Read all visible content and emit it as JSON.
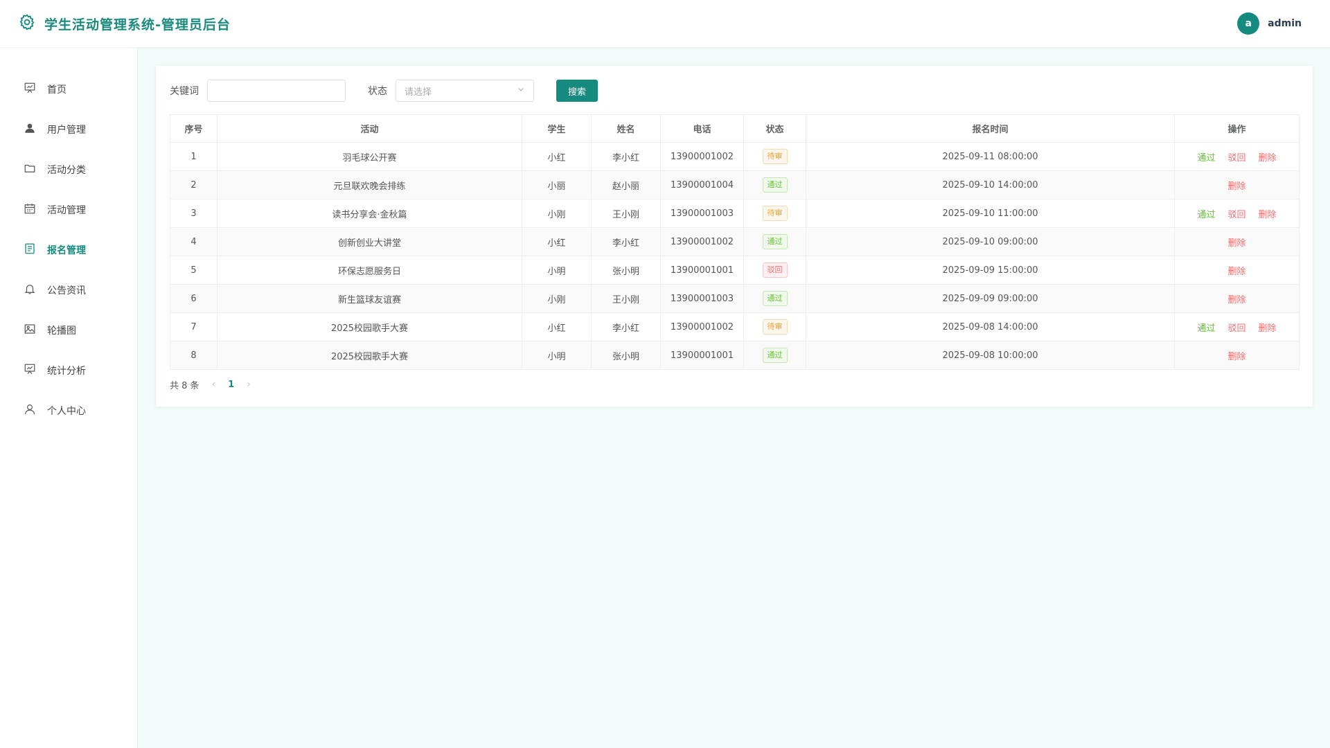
{
  "header": {
    "title": "学生活动管理系统-管理员后台",
    "avatar_letter": "a",
    "username": "admin"
  },
  "sidebar": {
    "items": [
      {
        "label": "首页",
        "icon": "presentation-icon",
        "active": false
      },
      {
        "label": "用户管理",
        "icon": "user-solid-icon",
        "active": false
      },
      {
        "label": "活动分类",
        "icon": "folder-icon",
        "active": false
      },
      {
        "label": "活动管理",
        "icon": "calendar-icon",
        "active": false
      },
      {
        "label": "报名管理",
        "icon": "document-icon",
        "active": true
      },
      {
        "label": "公告资讯",
        "icon": "bell-icon",
        "active": false
      },
      {
        "label": "轮播图",
        "icon": "picture-icon",
        "active": false
      },
      {
        "label": "统计分析",
        "icon": "chart-board-icon",
        "active": false
      },
      {
        "label": "个人中心",
        "icon": "user-outline-icon",
        "active": false
      }
    ]
  },
  "search": {
    "keyword_label": "关键词",
    "keyword_value": "",
    "keyword_placeholder": "",
    "status_label": "状态",
    "status_placeholder": "请选择",
    "button_label": "搜索"
  },
  "table": {
    "columns": [
      "序号",
      "活动",
      "学生",
      "姓名",
      "电话",
      "状态",
      "报名时间",
      "操作"
    ],
    "rows": [
      {
        "index": "1",
        "activity": "羽毛球公开赛",
        "student": "小红",
        "name": "李小红",
        "phone": "13900001002",
        "status": "待审",
        "status_type": "pending",
        "time": "2025-09-11 08:00:00"
      },
      {
        "index": "2",
        "activity": "元旦联欢晚会排练",
        "student": "小丽",
        "name": "赵小丽",
        "phone": "13900001004",
        "status": "通过",
        "status_type": "pass",
        "time": "2025-09-10 14:00:00"
      },
      {
        "index": "3",
        "activity": "读书分享会·金秋篇",
        "student": "小刚",
        "name": "王小刚",
        "phone": "13900001003",
        "status": "待审",
        "status_type": "pending",
        "time": "2025-09-10 11:00:00"
      },
      {
        "index": "4",
        "activity": "创新创业大讲堂",
        "student": "小红",
        "name": "李小红",
        "phone": "13900001002",
        "status": "通过",
        "status_type": "pass",
        "time": "2025-09-10 09:00:00"
      },
      {
        "index": "5",
        "activity": "环保志愿服务日",
        "student": "小明",
        "name": "张小明",
        "phone": "13900001001",
        "status": "驳回",
        "status_type": "reject",
        "time": "2025-09-09 15:00:00"
      },
      {
        "index": "6",
        "activity": "新生篮球友谊赛",
        "student": "小刚",
        "name": "王小刚",
        "phone": "13900001003",
        "status": "通过",
        "status_type": "pass",
        "time": "2025-09-09 09:00:00"
      },
      {
        "index": "7",
        "activity": "2025校园歌手大赛",
        "student": "小红",
        "name": "李小红",
        "phone": "13900001002",
        "status": "待审",
        "status_type": "pending",
        "time": "2025-09-08 14:00:00"
      },
      {
        "index": "8",
        "activity": "2025校园歌手大赛",
        "student": "小明",
        "name": "张小明",
        "phone": "13900001001",
        "status": "通过",
        "status_type": "pass",
        "time": "2025-09-08 10:00:00"
      }
    ],
    "ops": {
      "pass": "通过",
      "reject": "驳回",
      "delete": "删除"
    }
  },
  "pagination": {
    "total_text": "共 8 条",
    "prev": "‹",
    "current": "1",
    "next": "›"
  },
  "colors": {
    "brand": "#148b7e",
    "pending": "#e6a23c",
    "pass": "#67c23a",
    "reject": "#f56c6c"
  }
}
